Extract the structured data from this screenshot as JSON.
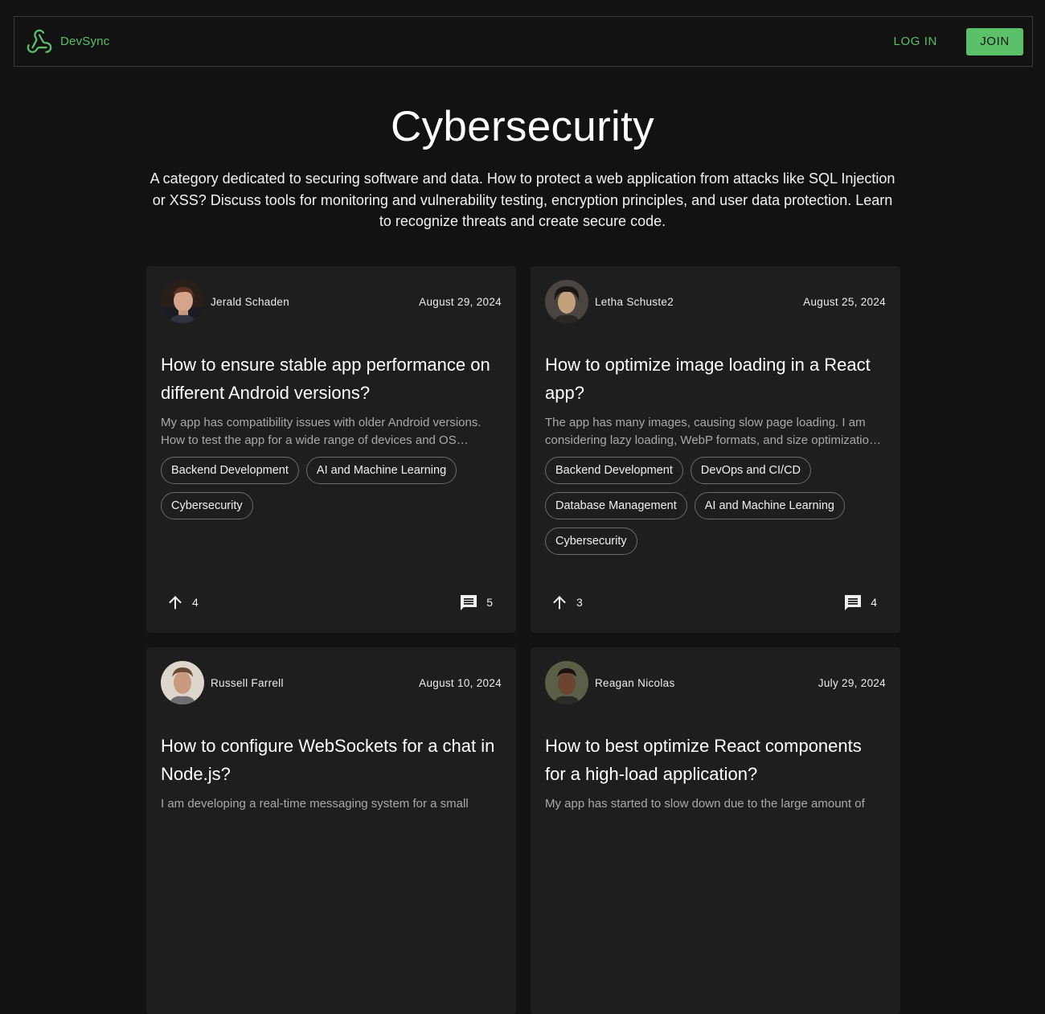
{
  "header": {
    "brand_name": "DevSync",
    "login_label": "LOG IN",
    "join_label": "JOIN",
    "accent_color": "#5cbf6a"
  },
  "hero": {
    "title": "Cybersecurity",
    "description": "A category dedicated to securing software and data. How to protect a web application from attacks like SQL Injection or XSS? Discuss tools for monitoring and vulnerability testing, encryption principles, and user data protection. Learn to recognize threats and create secure code."
  },
  "posts": [
    {
      "author": "Jerald Schaden",
      "date": "August 29, 2024",
      "title": "How to ensure stable app performance on different Android versions?",
      "excerpt": "My app has compatibility issues with older Android versions. How to test the app for a wide range of devices and OS versions to make sure everything works properly?",
      "tags": [
        "Backend Development",
        "AI and Machine Learning",
        "Cybersecurity"
      ],
      "upvotes": "4",
      "comments": "5"
    },
    {
      "author": "Letha Schuste2",
      "date": "August 25, 2024",
      "title": "How to optimize image loading in a React app?",
      "excerpt": "The app has many images, causing slow page loading. I am considering lazy loading, WebP formats, and size optimization. What approaches work best?",
      "tags": [
        "Backend Development",
        "DevOps and CI/CD",
        "Database Management",
        "AI and Machine Learning",
        "Cybersecurity"
      ],
      "upvotes": "3",
      "comments": "4"
    },
    {
      "author": "Russell Farrell",
      "date": "August 10, 2024",
      "title": "How to configure WebSockets for a chat in Node.js?",
      "excerpt": "I am developing a real-time messaging system for a small",
      "tags": [],
      "upvotes": "",
      "comments": ""
    },
    {
      "author": "Reagan Nicolas",
      "date": "July 29, 2024",
      "title": "How to best optimize React components for a high-load application?",
      "excerpt": "My app has started to slow down due to the large amount of",
      "tags": [],
      "upvotes": "",
      "comments": ""
    }
  ],
  "icons": {
    "logo": "webhook-logo-icon",
    "upvote": "arrow-up-icon",
    "comments": "comment-icon"
  }
}
